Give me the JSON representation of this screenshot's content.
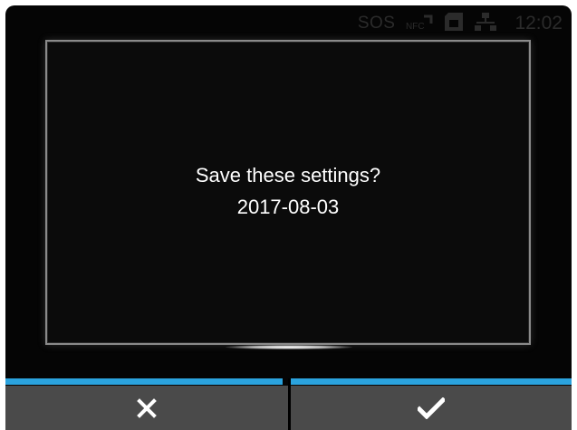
{
  "status_bar": {
    "sos_label": "SOS",
    "time": "12:02",
    "icons": [
      "nfc-icon",
      "sd-card-icon",
      "network-icon"
    ]
  },
  "dialog": {
    "message": "Save these settings?",
    "date_value": "2017-08-03"
  },
  "buttons": {
    "cancel_icon": "x-icon",
    "confirm_icon": "checkmark-icon"
  },
  "colors": {
    "accent": "#2ba3de",
    "button_bg": "#4a4a4a",
    "screen_bg": "#050505"
  }
}
